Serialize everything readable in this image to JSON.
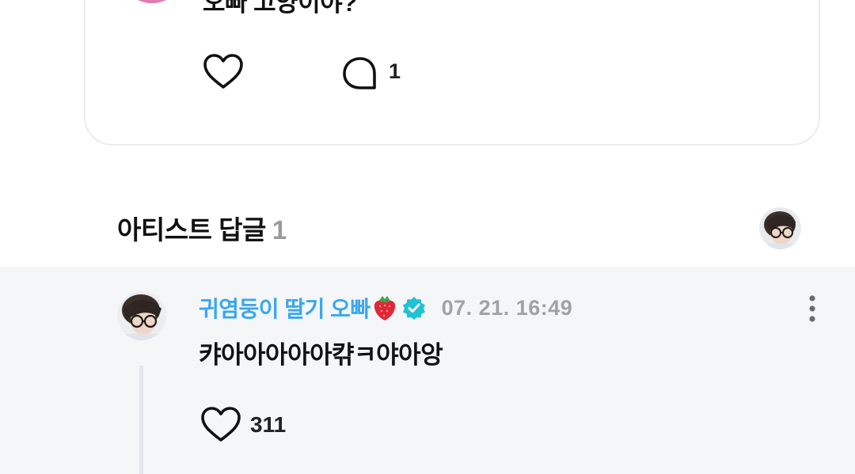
{
  "post": {
    "text": "오빠 고양이야?",
    "comment_count": "1",
    "icons": {
      "like": "heart-outline-icon",
      "comment": "comment-bubble-icon"
    }
  },
  "artist_replies": {
    "title": "아티스트 답글",
    "count": "1"
  },
  "reply": {
    "author": "귀염둥이 딸기 오빠",
    "author_emoji": "strawberry-icon",
    "verified": true,
    "time": "07. 21. 16:49",
    "text": "캬아아아아아캮ㅋ야아앙",
    "like_count": "311"
  },
  "colors": {
    "author_blue": "#3aa7ee",
    "verified_teal": "#1ec3d4",
    "reply_bg": "#f4f6f8",
    "muted_gray": "#a2a2a2"
  }
}
